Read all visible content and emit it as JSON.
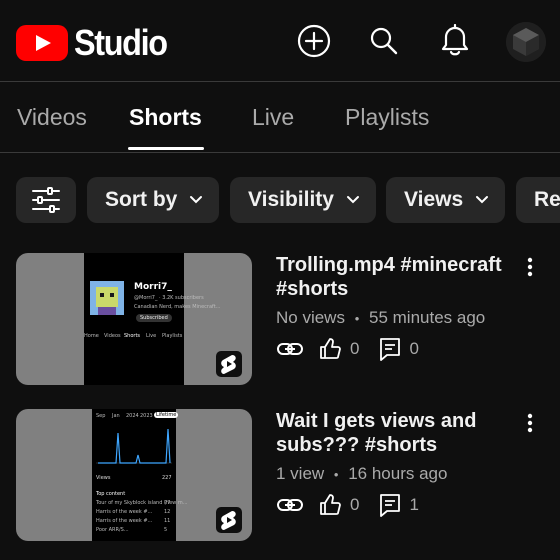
{
  "app": {
    "logo_text": "Studio",
    "brand_color": "#ff0000"
  },
  "header": {
    "icons": [
      "create-icon",
      "search-icon",
      "notifications-icon",
      "account-avatar"
    ]
  },
  "tabs": [
    {
      "label": "Videos",
      "active": false
    },
    {
      "label": "Shorts",
      "active": true
    },
    {
      "label": "Live",
      "active": false
    },
    {
      "label": "Playlists",
      "active": false
    }
  ],
  "filters": [
    {
      "label": "Sort by"
    },
    {
      "label": "Visibility"
    },
    {
      "label": "Views"
    },
    {
      "label": "Re"
    }
  ],
  "videos": [
    {
      "title": "Trolling.mp4 #minecraft #shorts",
      "views": "No views",
      "separator": "•",
      "age": "55 minutes ago",
      "likes": "0",
      "comments": "0",
      "thumb": {
        "channel": "Morri7_",
        "sub": "@Morri7_ · 3.2K subscribers",
        "desc": "Canadian Nerd, makes Minecraft...",
        "subscribed": "Subscribed",
        "tabs": [
          "Home",
          "Videos",
          "Shorts",
          "Live",
          "Playlists"
        ]
      }
    },
    {
      "title": "Wait I gets views and subs??? #shorts",
      "views": "1 view",
      "separator": "•",
      "age": "16 hours ago",
      "likes": "0",
      "comments": "1",
      "thumb": {
        "periods": [
          "Sep",
          "Jan",
          "2024",
          "2023",
          "Lifetime"
        ],
        "views_label": "Views",
        "views_value": "227",
        "top_content": "Top content",
        "rows": [
          {
            "label": "Tour of my Skyblock island (new m...",
            "value": "77"
          },
          {
            "label": "Harris of the week #...",
            "value": "12"
          },
          {
            "label": "Harris of the week #...",
            "value": "11"
          },
          {
            "label": "Poor ARR/S...",
            "value": "5"
          }
        ]
      }
    }
  ]
}
